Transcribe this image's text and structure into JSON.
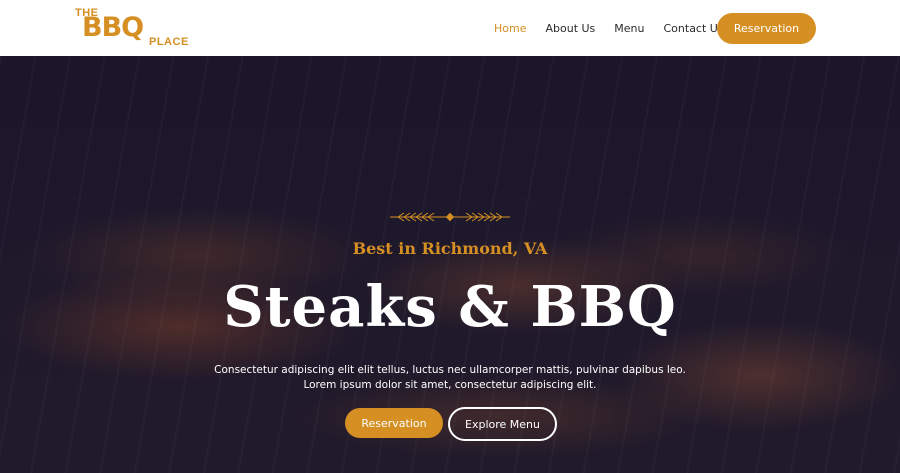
{
  "brand": {
    "line1": "THE",
    "line2": "BBQ",
    "line3": "PLACE",
    "color": "#d58f23"
  },
  "nav": {
    "items": [
      {
        "label": "Home",
        "active": true
      },
      {
        "label": "About Us",
        "active": false
      },
      {
        "label": "Menu",
        "active": false
      },
      {
        "label": "Contact Us",
        "active": false
      }
    ],
    "reservation_label": "Reservation"
  },
  "hero": {
    "ornament_icon": "wheat-divider-icon",
    "subtitle": "Best in Richmond, VA",
    "title": "Steaks & BBQ",
    "description_line1": "Consectetur adipiscing elit elit tellus, luctus nec ullamcorper mattis, pulvinar dapibus leo.",
    "description_line2": "Lorem ipsum dolor sit amet, consectetur adipiscing elit.",
    "primary_button": "Reservation",
    "secondary_button": "Explore Menu"
  }
}
